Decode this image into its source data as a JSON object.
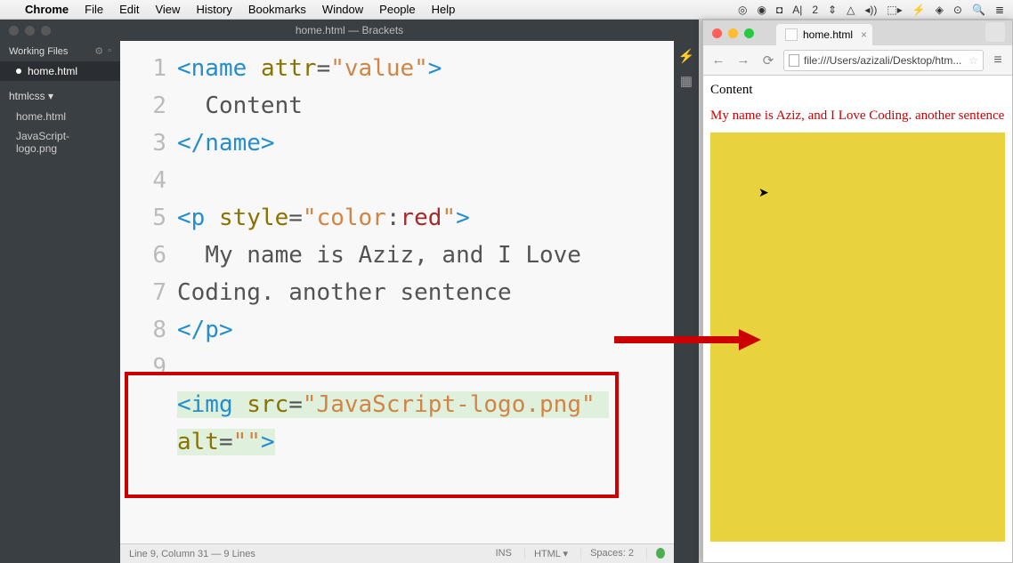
{
  "menubar": {
    "apple": "",
    "items": [
      "Chrome",
      "File",
      "Edit",
      "View",
      "History",
      "Bookmarks",
      "Window",
      "People",
      "Help"
    ],
    "status_icons": [
      "◎",
      "◉",
      "◘",
      "A|",
      "2",
      "⇕",
      "△",
      "◂))",
      "⬚▸",
      "⚡",
      "◈",
      "⊙",
      "🔍",
      "≣"
    ]
  },
  "brackets": {
    "title": "home.html — Brackets",
    "sidebar": {
      "working_files_label": "Working Files",
      "working_files": [
        "home.html"
      ],
      "project_label": "htmlcss ▾",
      "project_files": [
        "home.html",
        "JavaScript-logo.png"
      ]
    },
    "code_lines": [
      {
        "n": "1",
        "html": "<span class='tag'>&lt;name</span> <span class='attr'>attr</span>=<span class='string'>\"value\"</span><span class='tag'>&gt;</span>"
      },
      {
        "n": "2",
        "html": "  Content"
      },
      {
        "n": "3",
        "html": "<span class='tag'>&lt;/name&gt;</span>"
      },
      {
        "n": "4",
        "html": ""
      },
      {
        "n": "5",
        "html": "<span class='tag'>&lt;p</span> <span class='attr'>style</span>=<span class='string'>\"</span><span class='keyword'>color</span>:<span class='value-red'>red</span><span class='string'>\"</span><span class='tag'>&gt;</span>"
      },
      {
        "n": "6",
        "html": "  My name is Aziz, and I Love Coding. another sentence"
      },
      {
        "n": "7",
        "html": "<span class='tag'>&lt;/p&gt;</span>"
      },
      {
        "n": "8",
        "html": ""
      },
      {
        "n": "9",
        "html": "<span class='hl'><span class='tag'>&lt;img</span> <span class='attr'>src</span>=<span class='string'>\"JavaScript-logo.png\"</span> <span class='attr'>alt</span>=<span class='string'>\"\"</span><span class='tag'>&gt;</span></span>"
      }
    ],
    "status": {
      "cursor": "Line 9, Column 31 — 9 Lines",
      "ins": "INS",
      "lang": "HTML ▾",
      "spaces": "Spaces: 2"
    }
  },
  "chrome": {
    "tab_title": "home.html",
    "url": "file:///Users/azizali/Desktop/htm...",
    "content_text": "Content",
    "red_paragraph": "My name is Aziz, and I Love Coding. another sentence"
  }
}
